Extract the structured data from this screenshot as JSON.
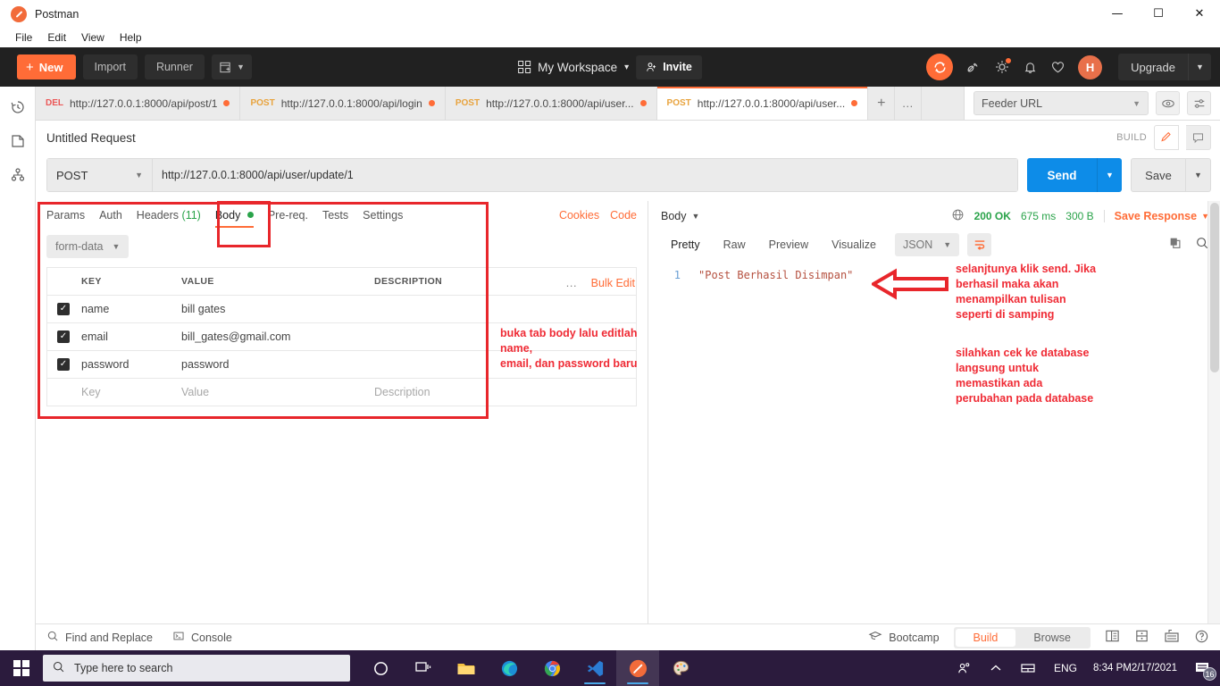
{
  "window": {
    "app_title": "Postman",
    "logo_icon": "postman-logo-icon",
    "minimize": "—",
    "maximize": "☐",
    "close": "✕"
  },
  "menubar": {
    "items": [
      "File",
      "Edit",
      "View",
      "Help"
    ]
  },
  "toolbar": {
    "new_label": "New",
    "new_plus": "+",
    "import_label": "Import",
    "runner_label": "Runner",
    "workspace_label": "My Workspace",
    "invite_label": "Invite",
    "upgrade_label": "Upgrade",
    "avatar_initial": "H",
    "icons": [
      "sync-icon",
      "satellite-icon",
      "gear-icon",
      "bell-icon",
      "heart-icon"
    ]
  },
  "leftrail": {
    "items": [
      "history-icon",
      "collections-icon",
      "apis-icon"
    ]
  },
  "tabs": [
    {
      "method": "DEL",
      "method_class": "del",
      "url": "http://127.0.0.1:8000/api/post/1",
      "unsaved": true,
      "active": false
    },
    {
      "method": "POST",
      "method_class": "post",
      "url": "http://127.0.0.1:8000/api/login",
      "unsaved": true,
      "active": false
    },
    {
      "method": "POST",
      "method_class": "post",
      "url": "http://127.0.0.1:8000/api/user...",
      "unsaved": true,
      "active": false
    },
    {
      "method": "POST",
      "method_class": "post",
      "url": "http://127.0.0.1:8000/api/user...",
      "unsaved": true,
      "active": true
    }
  ],
  "tabstrip": {
    "new_tab": "+",
    "more_tabs": "●●●",
    "environment_selected": "Feeder URL",
    "eye_icon": "eye-icon",
    "settings_icon": "sliders-icon"
  },
  "request": {
    "title": "Untitled Request",
    "build_label": "BUILD",
    "method": "POST",
    "url": "http://127.0.0.1:8000/api/user/update/1",
    "send_label": "Send",
    "save_label": "Save",
    "subtabs": [
      {
        "label": "Params",
        "active": false
      },
      {
        "label": "Auth",
        "active": false
      },
      {
        "label": "Headers",
        "count": "(11)",
        "active": false
      },
      {
        "label": "Body",
        "active": true,
        "dot": true
      },
      {
        "label": "Pre-req.",
        "active": false
      },
      {
        "label": "Tests",
        "active": false
      },
      {
        "label": "Settings",
        "active": false
      }
    ],
    "cookies_label": "Cookies",
    "code_label": "Code",
    "body_type": "form-data",
    "bulk_edit_label": "Bulk Edit",
    "table": {
      "headers": [
        "KEY",
        "VALUE",
        "DESCRIPTION"
      ],
      "rows": [
        {
          "checked": true,
          "key": "name",
          "value": "bill gates",
          "description": ""
        },
        {
          "checked": true,
          "key": "email",
          "value": "bill_gates@gmail.com",
          "description": ""
        },
        {
          "checked": true,
          "key": "password",
          "value": "password",
          "description": ""
        }
      ],
      "placeholder_row": {
        "key": "Key",
        "value": "Value",
        "description": "Description"
      }
    }
  },
  "response": {
    "body_label": "Body",
    "status": "200 OK",
    "time": "675 ms",
    "size": "300 B",
    "save_response_label": "Save Response",
    "tabs": [
      {
        "label": "Pretty",
        "active": true
      },
      {
        "label": "Raw",
        "active": false
      },
      {
        "label": "Preview",
        "active": false
      },
      {
        "label": "Visualize",
        "active": false
      }
    ],
    "format": "JSON",
    "line_number": "1",
    "body_text": "\"Post Berhasil Disimpan\""
  },
  "annotations": {
    "left_note": "buka tab body lalu editlah name,\nemail, dan password baru",
    "right_note_1": "selanjtunya klik send. Jika\nberhasil maka akan\nmenampilkan tulisan\nseperti di samping",
    "right_note_2": "silahkan cek ke database\nlangsung untuk\nmemastikan ada\nperubahan pada database",
    "color": "#ef2b35"
  },
  "statusbar": {
    "find_replace": "Find and Replace",
    "console": "Console",
    "bootcamp": "Bootcamp",
    "build_label": "Build",
    "browse_label": "Browse"
  },
  "taskbar": {
    "search_placeholder": "Type here to search",
    "apps": [
      "cortana-icon",
      "task-view-icon",
      "file-explorer-icon",
      "edge-icon",
      "chrome-icon",
      "vscode-icon",
      "postman-icon",
      "paint-icon"
    ],
    "language": "ENG",
    "time": "8:34 PM",
    "date": "2/17/2021",
    "notification_count": "16"
  }
}
